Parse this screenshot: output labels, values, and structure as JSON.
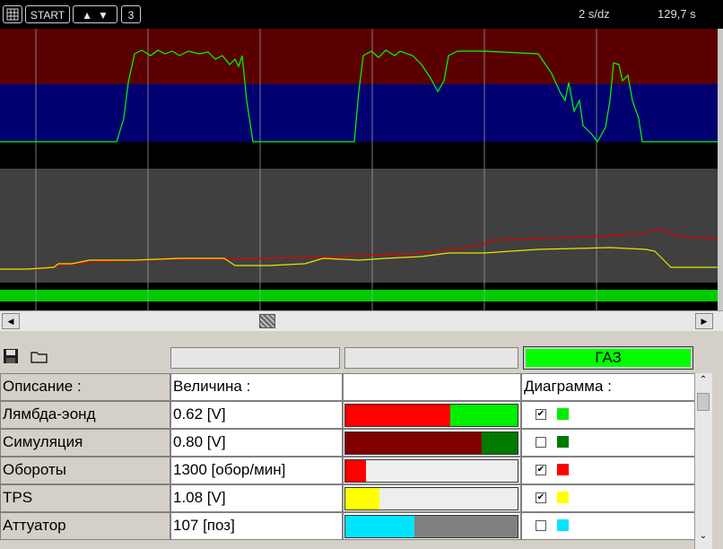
{
  "toolbar": {
    "grid_icon": "grid-icon",
    "start_label": "START",
    "up_icon": "▲",
    "down_icon": "▼",
    "count": "3",
    "timebase": "2 s/dz",
    "time": "129,7 s"
  },
  "chart_data": {
    "type": "line",
    "bands": [
      {
        "name": "dark-red-band",
        "color": "#5a0000"
      },
      {
        "name": "blue-band",
        "color": "#000070"
      },
      {
        "name": "gray-band",
        "color": "#404040"
      },
      {
        "name": "green-band",
        "color": "#00cc00"
      }
    ],
    "series": [
      {
        "color": "#00ff00",
        "role": "lambda-signal"
      },
      {
        "color": "#e00000",
        "role": "rpm-signal"
      },
      {
        "color": "#e6e600",
        "role": "tps-signal"
      }
    ],
    "grid": true
  },
  "panel": {
    "save_icon": "save-icon",
    "folder_icon": "folder-icon",
    "gas_label": "ГАЗ",
    "gas_color": "#00ff00",
    "headers": {
      "description": "Описание :",
      "value": "Величина :",
      "diagram": "Диаграмма :"
    },
    "rows": [
      {
        "name": "Лямбда-эонд",
        "value": "0.62 [V]",
        "level": 0.61,
        "fill": "#ff0000",
        "rest": "#00ee00",
        "checked": true,
        "check_mark": "✔",
        "swatch": "#00ee00"
      },
      {
        "name": "Симуляция",
        "value": "0.80 [V]",
        "level": 0.79,
        "fill": "#800000",
        "rest": "#007a00",
        "checked": false,
        "check_mark": "",
        "swatch": "#007a00"
      },
      {
        "name": "Обороты",
        "value": "1300 [обор/мин]",
        "level": 0.12,
        "fill": "#ff0000",
        "rest": "#eeeeee",
        "checked": true,
        "check_mark": "✔",
        "swatch": "#ff0000"
      },
      {
        "name": "TPS",
        "value": "1.08 [V]",
        "level": 0.2,
        "fill": "#ffff00",
        "rest": "#eeeeee",
        "checked": true,
        "check_mark": "✔",
        "swatch": "#ffff00"
      },
      {
        "name": "Аттуатор",
        "value": "107 [поз]",
        "level": 0.4,
        "fill": "#00e5ff",
        "rest": "#808080",
        "checked": false,
        "check_mark": "",
        "swatch": "#00e5ff"
      }
    ]
  }
}
